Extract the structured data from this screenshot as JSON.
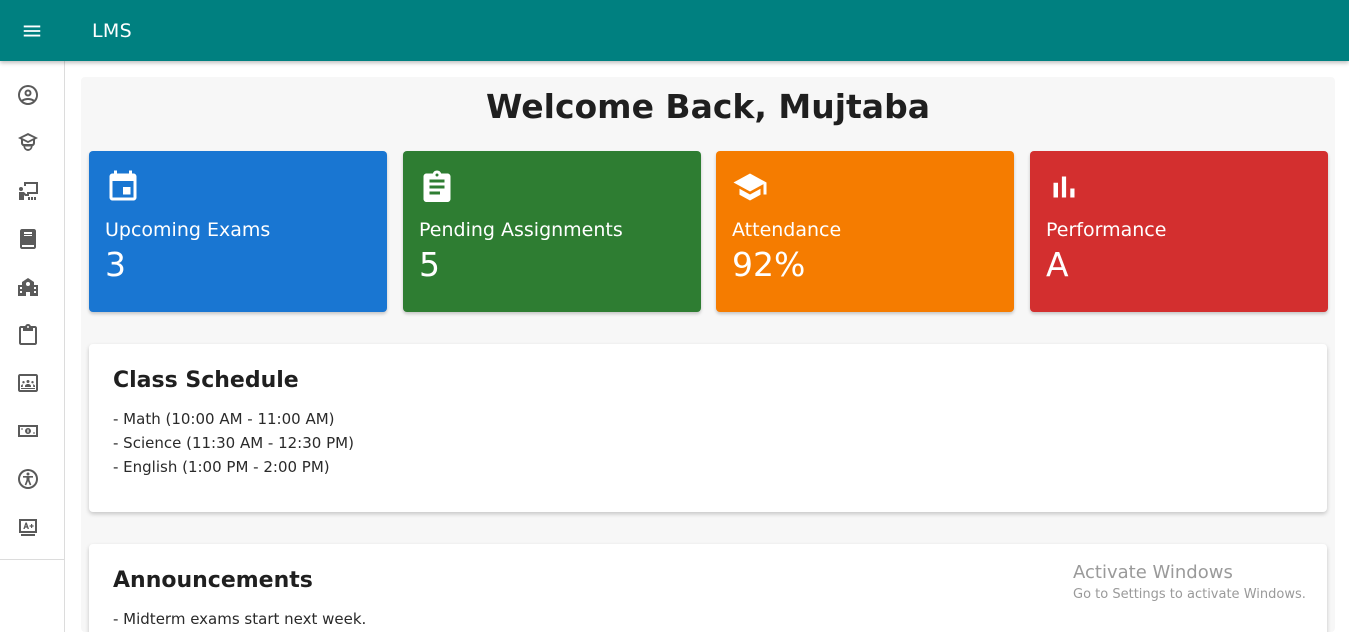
{
  "app": {
    "title": "LMS"
  },
  "sidebar": {
    "items": [
      {
        "icon": "account-circle-icon"
      },
      {
        "icon": "school-cap-icon"
      },
      {
        "icon": "classroom-icon"
      },
      {
        "icon": "book-icon"
      },
      {
        "icon": "building-icon"
      },
      {
        "icon": "clipboard-icon"
      },
      {
        "icon": "people-board-icon"
      },
      {
        "icon": "money-icon"
      },
      {
        "icon": "accessibility-icon"
      },
      {
        "icon": "grade-icon"
      }
    ]
  },
  "main": {
    "welcome": "Welcome Back, Mujtaba",
    "stats": [
      {
        "label": "Upcoming Exams",
        "value": "3",
        "icon": "calendar-icon",
        "color": "#1976d2"
      },
      {
        "label": "Pending Assignments",
        "value": "5",
        "icon": "assignment-icon",
        "color": "#2e7d32"
      },
      {
        "label": "Attendance",
        "value": "92%",
        "icon": "school-icon",
        "color": "#f57c00"
      },
      {
        "label": "Performance",
        "value": "A",
        "icon": "bar-chart-icon",
        "color": "#d32f2f"
      }
    ],
    "schedule": {
      "title": "Class Schedule",
      "items": [
        "- Math (10:00 AM - 11:00 AM)",
        "- Science (11:30 AM - 12:30 PM)",
        "- English (1:00 PM - 2:00 PM)"
      ]
    },
    "announcements": {
      "title": "Announcements",
      "items": [
        "- Midterm exams start next week."
      ]
    }
  },
  "watermark": {
    "title": "Activate Windows",
    "subtitle": "Go to Settings to activate Windows."
  }
}
